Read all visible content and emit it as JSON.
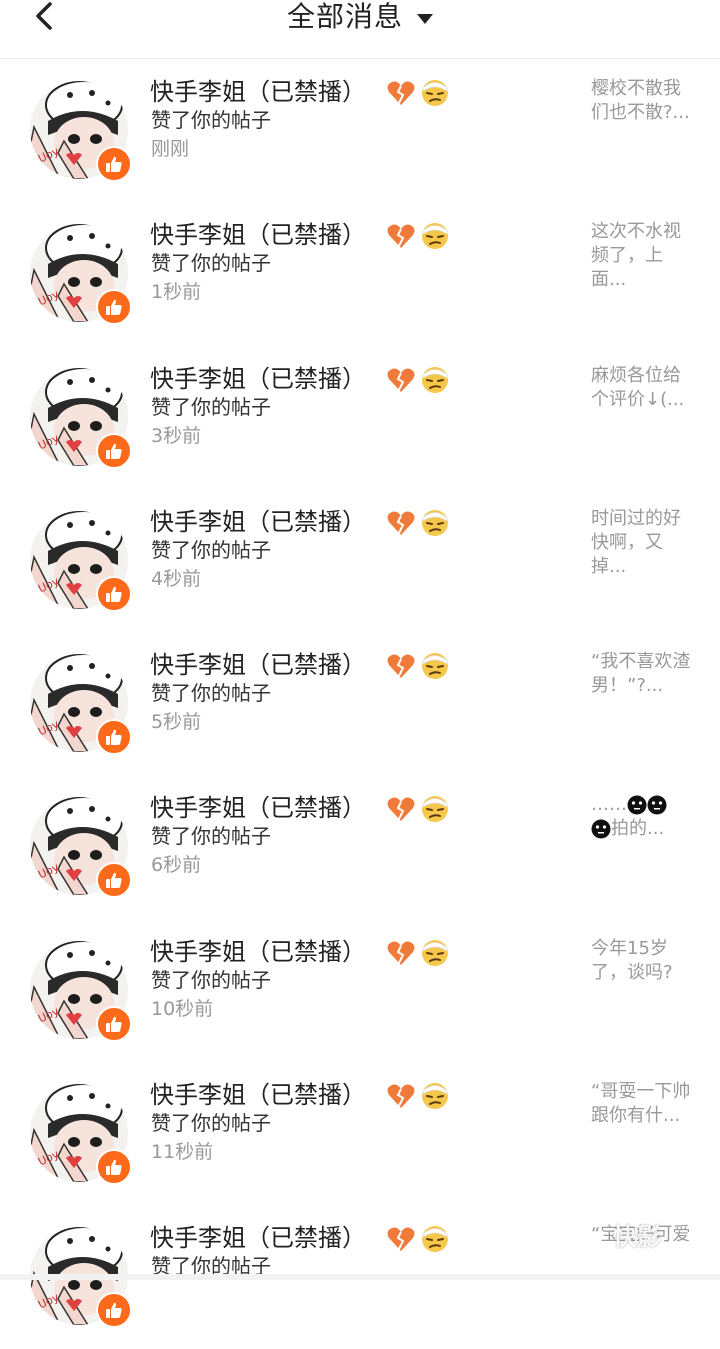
{
  "header": {
    "title": "全部消息",
    "back_icon": "chevron-left-icon",
    "dropdown_icon": "caret-down-icon"
  },
  "colors": {
    "like_badge": "#ff6a1a",
    "heart_emoji": "#f07a3a",
    "face_emoji": "#f5c84c",
    "secondary_text": "#999999"
  },
  "messages": [
    {
      "name": "快手李姐（已禁播）",
      "action": "赞了你的帖子",
      "time": "刚刚",
      "preview": "樱校不散我们也不散?..."
    },
    {
      "name": "快手李姐（已禁播）",
      "action": "赞了你的帖子",
      "time": "1秒前",
      "preview": "这次不水视频了，上面..."
    },
    {
      "name": "快手李姐（已禁播）",
      "action": "赞了你的帖子",
      "time": "3秒前",
      "preview": "麻烦各位给个评价↓(..."
    },
    {
      "name": "快手李姐（已禁播）",
      "action": "赞了你的帖子",
      "time": "4秒前",
      "preview": "时间过的好快啊，又掉..."
    },
    {
      "name": "快手李姐（已禁播）",
      "action": "赞了你的帖子",
      "time": "5秒前",
      "preview": "“我不喜欢渣男！”?..."
    },
    {
      "name": "快手李姐（已禁播）",
      "action": "赞了你的帖子",
      "time": "6秒前",
      "preview_prefix": "……",
      "preview_suffix": "拍的..."
    },
    {
      "name": "快手李姐（已禁播）",
      "action": "赞了你的帖子",
      "time": "10秒前",
      "preview": "今年15岁了，谈吗?"
    },
    {
      "name": "快手李姐（已禁播）",
      "action": "赞了你的帖子",
      "time": "11秒前",
      "preview": "“哥耍一下帅跟你有什..."
    },
    {
      "name": "快手李姐（已禁播）",
      "action": "赞了你的帖子",
      "time": "",
      "preview": "“宝宝好可爱"
    }
  ],
  "watermark": "快影"
}
